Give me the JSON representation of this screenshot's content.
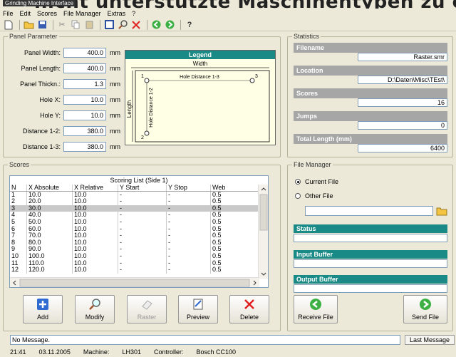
{
  "window_title": "Grinding Machine Interface",
  "banner_text": "nicht unterstützte Maschinentypen zu erw",
  "menu": [
    "File",
    "Edit",
    "Scores",
    "File Manager",
    "Extras",
    "?"
  ],
  "toolbar_icons": [
    "new-file-icon",
    "open-folder-icon",
    "save-icon",
    "cut-icon",
    "copy-icon",
    "paste-icon",
    "window-icon",
    "search-icon",
    "delete-icon",
    "back-icon",
    "forward-icon",
    "help-icon"
  ],
  "panel_parameter": {
    "title": "Panel Parameter",
    "fields": [
      {
        "label": "Panel Width:",
        "value": "400.0",
        "unit": "mm"
      },
      {
        "label": "Panel Length:",
        "value": "400.0",
        "unit": "mm"
      },
      {
        "label": "Panel Thickn.:",
        "value": "1.3",
        "unit": "mm"
      },
      {
        "label": "Hole X:",
        "value": "10.0",
        "unit": "mm"
      },
      {
        "label": "Hole Y:",
        "value": "10.0",
        "unit": "mm"
      },
      {
        "label": "Distance 1-2:",
        "value": "380.0",
        "unit": "mm"
      },
      {
        "label": "Distance 1-3:",
        "value": "380.0",
        "unit": "mm"
      }
    ],
    "legend": {
      "title": "Legend",
      "width": "Width",
      "length": "Length",
      "hole13": "Hole Distance 1-3",
      "hole12": "Hole Distance 1-2",
      "n1": "1",
      "n2": "2",
      "n3": "3"
    }
  },
  "statistics": {
    "title": "Statistics",
    "items": [
      {
        "label": "Filename",
        "value": "Raster.smr"
      },
      {
        "label": "Location",
        "value": "D:\\Daten\\Misc\\TEst\\"
      },
      {
        "label": "Scores",
        "value": "16"
      },
      {
        "label": "Jumps",
        "value": "0"
      },
      {
        "label": "Total Length (mm)",
        "value": "6400"
      }
    ]
  },
  "scores": {
    "title": "Scores",
    "caption": "Scoring List (Side 1)",
    "columns": [
      "N",
      "X Absolute",
      "X Relative",
      "Y Start",
      "Y Stop",
      "Web"
    ],
    "rows": [
      [
        "1",
        "10.0",
        "10.0",
        "-",
        "-",
        "0.5"
      ],
      [
        "2",
        "20.0",
        "10.0",
        "-",
        "-",
        "0.5"
      ],
      [
        "3",
        "30.0",
        "10.0",
        "-",
        "-",
        "0.5"
      ],
      [
        "4",
        "40.0",
        "10.0",
        "-",
        "-",
        "0.5"
      ],
      [
        "5",
        "50.0",
        "10.0",
        "-",
        "-",
        "0.5"
      ],
      [
        "6",
        "60.0",
        "10.0",
        "-",
        "-",
        "0.5"
      ],
      [
        "7",
        "70.0",
        "10.0",
        "-",
        "-",
        "0.5"
      ],
      [
        "8",
        "80.0",
        "10.0",
        "-",
        "-",
        "0.5"
      ],
      [
        "9",
        "90.0",
        "10.0",
        "-",
        "-",
        "0.5"
      ],
      [
        "10",
        "100.0",
        "10.0",
        "-",
        "-",
        "0.5"
      ],
      [
        "11",
        "110.0",
        "10.0",
        "-",
        "-",
        "0.5"
      ],
      [
        "12",
        "120.0",
        "10.0",
        "-",
        "-",
        "0.5"
      ]
    ],
    "selected_row": 2,
    "buttons": {
      "add": "Add",
      "modify": "Modify",
      "raster": "Raster",
      "preview": "Preview",
      "delete": "Delete"
    }
  },
  "file_manager": {
    "title": "File Manager",
    "current_file": "Current File",
    "other_file": "Other File",
    "status": "Status",
    "input_buffer": "Input Buffer",
    "output_buffer": "Output Buffer",
    "receive": "Receive File",
    "send": "Send File"
  },
  "status": {
    "message": "No Message.",
    "last_message": "Last Message"
  },
  "bottom": {
    "time": "21:41",
    "date": "03.11.2005",
    "machine_label": "Machine:",
    "machine": "LH301",
    "controller_label": "Controller:",
    "controller": "Bosch CC100"
  },
  "colors": {
    "teal": "#1a8a86",
    "gray_label": "#a6a6a6",
    "background": "#ece9d8"
  }
}
